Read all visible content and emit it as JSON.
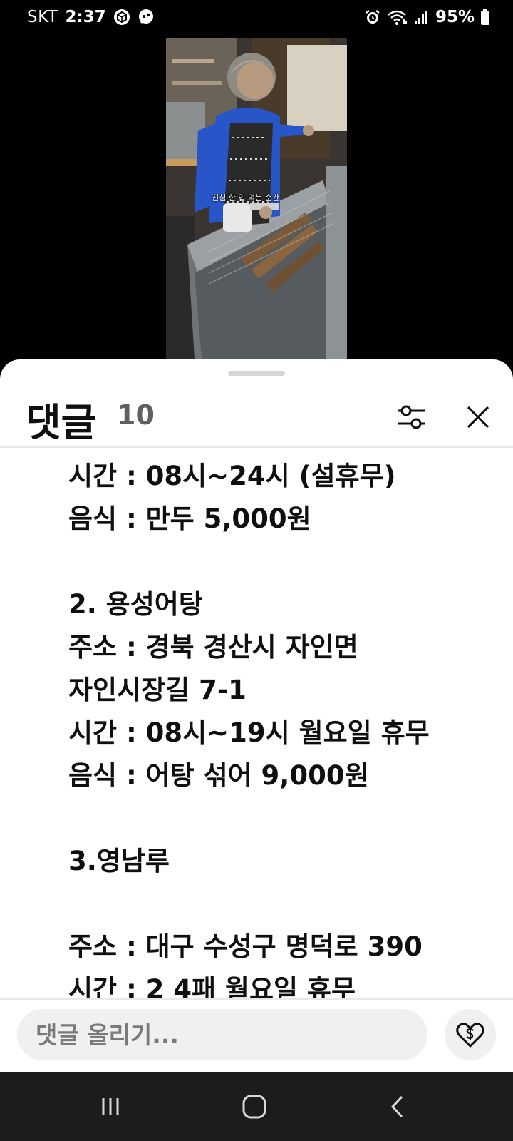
{
  "status_bar": {
    "carrier": "SKT",
    "time": "2:37",
    "battery": "95%"
  },
  "video": {
    "caption": "진심 한 입 먹는 순간"
  },
  "comments_sheet": {
    "title": "댓글",
    "count": "10"
  },
  "comment": {
    "lines": [
      "시간 : 08시~24시 (설휴무)",
      "음식 : 만두 5,000원",
      "",
      "2. 용성어탕",
      "주소 : 경북 경산시 자인면",
      "자인시장길 7-1",
      "시간 : 08시~19시 월요일 휴무",
      "음식 : 어탕 섞어 9,000원",
      "",
      "3.영남루",
      "",
      "주소 : 대구 수성구 명덕로 390",
      "시간 : 2 4패 월요일 휴무"
    ]
  },
  "input": {
    "placeholder": "댓글 올리기..."
  },
  "icons": {
    "filter": "sliders-icon",
    "close": "close-icon",
    "thanks": "heart-dollar-icon",
    "recents": "recents-icon",
    "home": "home-icon",
    "back": "back-icon"
  },
  "colors": {
    "background": "#000000",
    "sheet": "#ffffff",
    "text": "#0f0f0f",
    "secondary_text": "#606060",
    "input_bg": "#f0f0f0",
    "nav_bar": "#1c1c1c"
  }
}
